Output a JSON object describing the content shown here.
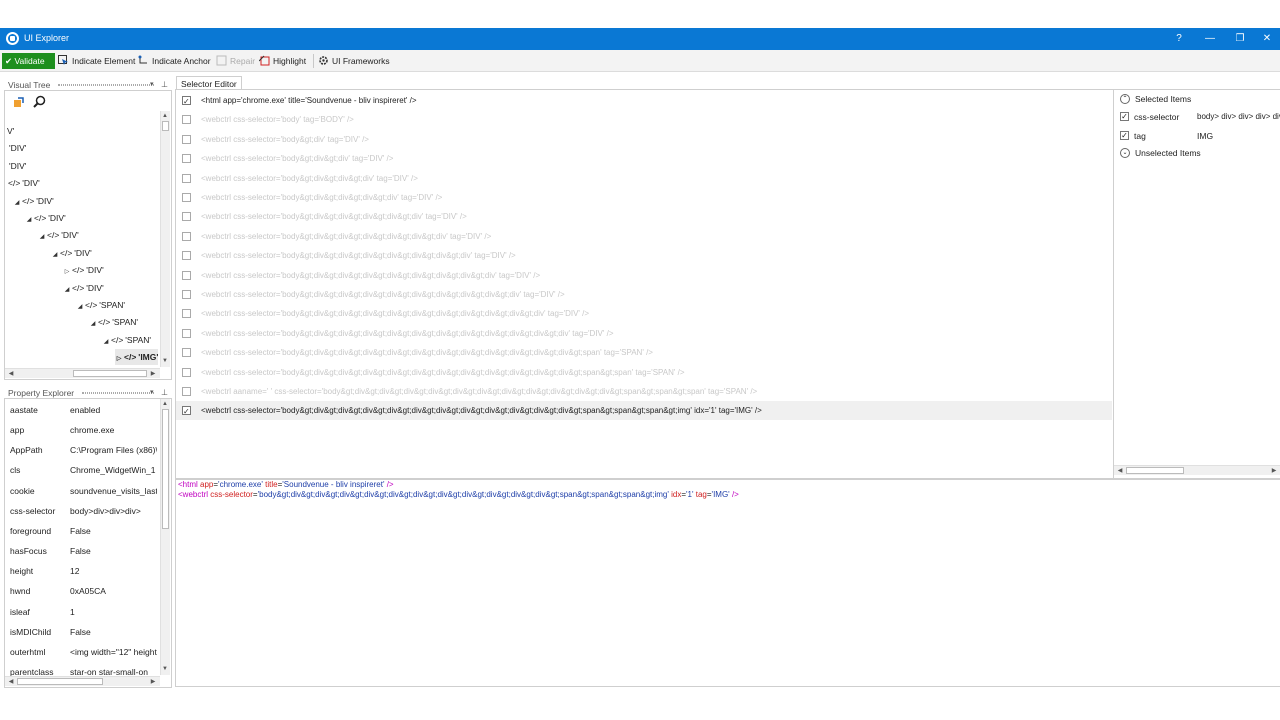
{
  "window": {
    "title": "UI Explorer",
    "help": "?",
    "minimize": "—",
    "restore": "❐",
    "close": "✕"
  },
  "toolbar": {
    "validate": "✔ Validate",
    "indicate_element": "Indicate Element",
    "indicate_anchor": "Indicate Anchor",
    "repair": "Repair",
    "highlight": "Highlight",
    "ui_frameworks": "UI Frameworks"
  },
  "visual_tree": {
    "title": "Visual Tree",
    "nodes": [
      {
        "label": "V'",
        "expander": "",
        "code": false
      },
      {
        "label": "'DIV'",
        "expander": "",
        "code": false
      },
      {
        "label": "'DIV'",
        "expander": "",
        "code": false
      },
      {
        "label": "'DIV'",
        "expander": "",
        "code": true
      },
      {
        "label": "'DIV'",
        "expander": "◢",
        "code": true
      },
      {
        "label": "'DIV'",
        "expander": "◢",
        "code": true
      },
      {
        "label": "'DIV'",
        "expander": "◢",
        "code": true
      },
      {
        "label": "'DIV'",
        "expander": "◢",
        "code": true
      },
      {
        "label": "'DIV'",
        "expander": "▷",
        "code": true
      },
      {
        "label": "'DIV'",
        "expander": "◢",
        "code": true
      },
      {
        "label": "'SPAN'",
        "expander": "◢",
        "code": true
      },
      {
        "label": "'SPAN'",
        "expander": "◢",
        "code": true
      },
      {
        "label": "'SPAN'",
        "expander": "◢",
        "code": true
      },
      {
        "label": "'IMG'",
        "expander": "▷",
        "code": true
      }
    ]
  },
  "property_explorer": {
    "title": "Property Explorer",
    "rows": [
      {
        "key": "aastate",
        "value": "enabled"
      },
      {
        "key": "app",
        "value": "chrome.exe"
      },
      {
        "key": "AppPath",
        "value": "C:\\Program Files (x86)\\Go"
      },
      {
        "key": "cls",
        "value": "Chrome_WidgetWin_1"
      },
      {
        "key": "cookie",
        "value": "soundvenue_visits_last30"
      },
      {
        "key": "css-selector",
        "value": "body>div>div>div>"
      },
      {
        "key": "foreground",
        "value": "False"
      },
      {
        "key": "hasFocus",
        "value": "False"
      },
      {
        "key": "height",
        "value": "12"
      },
      {
        "key": "hwnd",
        "value": "0xA05CA"
      },
      {
        "key": "isleaf",
        "value": "1"
      },
      {
        "key": "isMDIChild",
        "value": "False"
      },
      {
        "key": "outerhtml",
        "value": "<img width=\"12\" height="
      },
      {
        "key": "parentclass",
        "value": "star-on star-small-on"
      }
    ]
  },
  "selector_editor": {
    "tab": "Selector Editor",
    "rows": [
      {
        "text": "<html app='chrome.exe' title='Soundvenue - bliv inspireret' />",
        "checked": true,
        "state": "normal"
      },
      {
        "text": "<webctrl css-selector='body' tag='BODY' />",
        "checked": false,
        "state": "dim"
      },
      {
        "text": "<webctrl css-selector='body&gt;div' tag='DIV' />",
        "checked": false,
        "state": "dim"
      },
      {
        "text": "<webctrl css-selector='body&gt;div&gt;div' tag='DIV' />",
        "checked": false,
        "state": "dim"
      },
      {
        "text": "<webctrl css-selector='body&gt;div&gt;div&gt;div' tag='DIV' />",
        "checked": false,
        "state": "dim"
      },
      {
        "text": "<webctrl css-selector='body&gt;div&gt;div&gt;div&gt;div' tag='DIV' />",
        "checked": false,
        "state": "dim"
      },
      {
        "text": "<webctrl css-selector='body&gt;div&gt;div&gt;div&gt;div&gt;div' tag='DIV' />",
        "checked": false,
        "state": "dim"
      },
      {
        "text": "<webctrl css-selector='body&gt;div&gt;div&gt;div&gt;div&gt;div&gt;div' tag='DIV' />",
        "checked": false,
        "state": "dim"
      },
      {
        "text": "<webctrl css-selector='body&gt;div&gt;div&gt;div&gt;div&gt;div&gt;div&gt;div' tag='DIV' />",
        "checked": false,
        "state": "dim"
      },
      {
        "text": "<webctrl css-selector='body&gt;div&gt;div&gt;div&gt;div&gt;div&gt;div&gt;div&gt;div' tag='DIV' />",
        "checked": false,
        "state": "dim"
      },
      {
        "text": "<webctrl css-selector='body&gt;div&gt;div&gt;div&gt;div&gt;div&gt;div&gt;div&gt;div&gt;div' tag='DIV' />",
        "checked": false,
        "state": "dim"
      },
      {
        "text": "<webctrl css-selector='body&gt;div&gt;div&gt;div&gt;div&gt;div&gt;div&gt;div&gt;div&gt;div&gt;div' tag='DIV' />",
        "checked": false,
        "state": "dim"
      },
      {
        "text": "<webctrl css-selector='body&gt;div&gt;div&gt;div&gt;div&gt;div&gt;div&gt;div&gt;div&gt;div&gt;div&gt;div' tag='DIV' />",
        "checked": false,
        "state": "dim"
      },
      {
        "text": "<webctrl css-selector='body&gt;div&gt;div&gt;div&gt;div&gt;div&gt;div&gt;div&gt;div&gt;div&gt;div&gt;div&gt;span' tag='SPAN' />",
        "checked": false,
        "state": "dim"
      },
      {
        "text": "<webctrl css-selector='body&gt;div&gt;div&gt;div&gt;div&gt;div&gt;div&gt;div&gt;div&gt;div&gt;div&gt;div&gt;span&gt;span' tag='SPAN' />",
        "checked": false,
        "state": "dim"
      },
      {
        "text": "<webctrl aaname='                                                                  ' css-selector='body&gt;div&gt;div&gt;div&gt;div&gt;div&gt;div&gt;div&gt;div&gt;div&gt;div&gt;div&gt;span&gt;span&gt;span' tag='SPAN' />",
        "checked": false,
        "state": "dim"
      },
      {
        "text": "<webctrl css-selector='body&gt;div&gt;div&gt;div&gt;div&gt;div&gt;div&gt;div&gt;div&gt;div&gt;div&gt;div&gt;span&gt;span&gt;span&gt;img' idx='1' tag='IMG' />",
        "checked": true,
        "state": "active"
      }
    ]
  },
  "xml_preview": {
    "line1": [
      {
        "t": "<",
        "c": "tag"
      },
      {
        "t": "html",
        "c": "tag"
      },
      {
        "t": " app",
        "c": "attr"
      },
      {
        "t": "=",
        "c": "pun"
      },
      {
        "t": "'chrome.exe'",
        "c": "val"
      },
      {
        "t": " title",
        "c": "attr"
      },
      {
        "t": "=",
        "c": "pun"
      },
      {
        "t": "'Soundvenue - bliv inspireret'",
        "c": "val"
      },
      {
        "t": " />",
        "c": "tag"
      }
    ],
    "line2": [
      {
        "t": "<",
        "c": "tag"
      },
      {
        "t": "webctrl",
        "c": "tag"
      },
      {
        "t": " css-selector",
        "c": "attr"
      },
      {
        "t": "=",
        "c": "pun"
      },
      {
        "t": "'body&gt;div&gt;div&gt;div&gt;div&gt;div&gt;div&gt;div&gt;div&gt;div&gt;div&gt;div&gt;span&gt;span&gt;span&gt;img'",
        "c": "val"
      },
      {
        "t": " idx",
        "c": "attr"
      },
      {
        "t": "=",
        "c": "pun"
      },
      {
        "t": "'1'",
        "c": "val"
      },
      {
        "t": " tag",
        "c": "attr"
      },
      {
        "t": "=",
        "c": "pun"
      },
      {
        "t": "'IMG'",
        "c": "val"
      },
      {
        "t": " />",
        "c": "tag"
      }
    ]
  },
  "side_panel": {
    "selected_header": "Selected Items",
    "unselected_header": "Unselected Items",
    "items": [
      {
        "key": "css-selector",
        "value": "body> div> div> div> div"
      },
      {
        "key": "tag",
        "value": "IMG"
      }
    ]
  },
  "colors": {
    "titlebar": "#0a78d4",
    "validate": "#1e8f1e",
    "xml_tag": "#c000c0",
    "xml_attr": "#d02020",
    "xml_value": "#1e3ea8"
  }
}
